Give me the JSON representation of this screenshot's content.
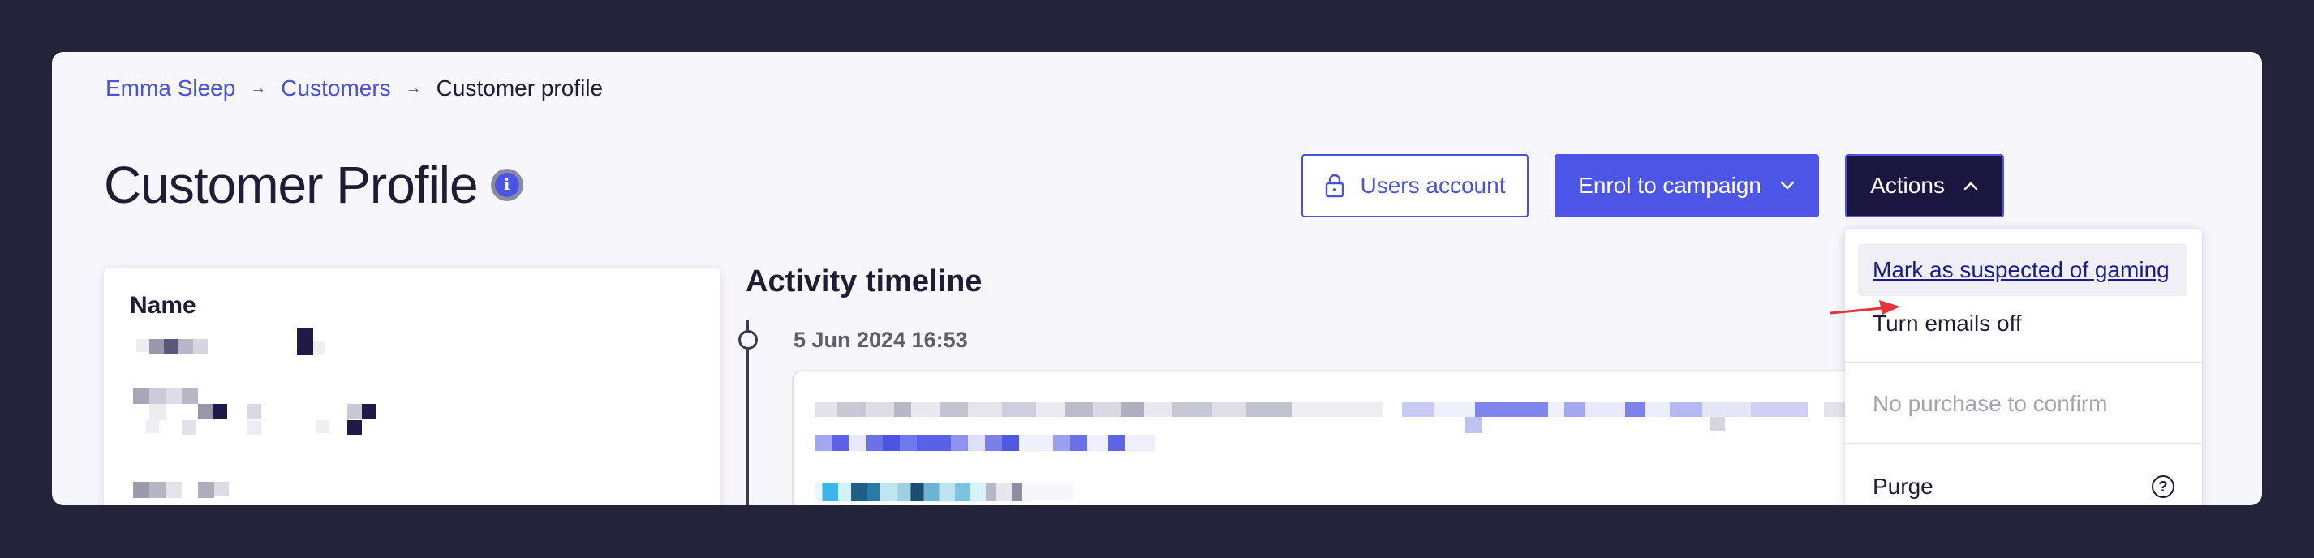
{
  "breadcrumb": {
    "items": [
      "Emma Sleep",
      "Customers"
    ],
    "current": "Customer profile",
    "separator": "→"
  },
  "page": {
    "title": "Customer Profile",
    "info_icon_glyph": "i"
  },
  "header_actions": {
    "users_account_label": "Users account",
    "enrol_label": "Enrol to campaign",
    "actions_label": "Actions"
  },
  "customer_panel": {
    "name_label": "Name"
  },
  "timeline": {
    "title": "Activity timeline",
    "entries": [
      {
        "date": "5 Jun 2024 16:53"
      }
    ]
  },
  "actions_menu": {
    "items": [
      {
        "label": "Mark as suspected of gaming",
        "state": "highlighted"
      },
      {
        "label": "Turn emails off",
        "state": "normal"
      },
      {
        "label": "No purchase to confirm",
        "state": "disabled"
      },
      {
        "label": "Purge",
        "state": "normal",
        "help_icon_glyph": "?"
      }
    ]
  },
  "colors": {
    "background": "#23233a",
    "card": "#f7f6fb",
    "primary": "#4d55e6",
    "dark": "#1b1740",
    "annotation_arrow": "#e8323c"
  },
  "icons": {
    "lock": "lock-icon",
    "chevron_down": "chevron-down-icon",
    "chevron_up": "chevron-up-icon",
    "info": "info-icon",
    "help": "help-circle-icon",
    "breadcrumb_separator": "arrow-right-icon"
  }
}
